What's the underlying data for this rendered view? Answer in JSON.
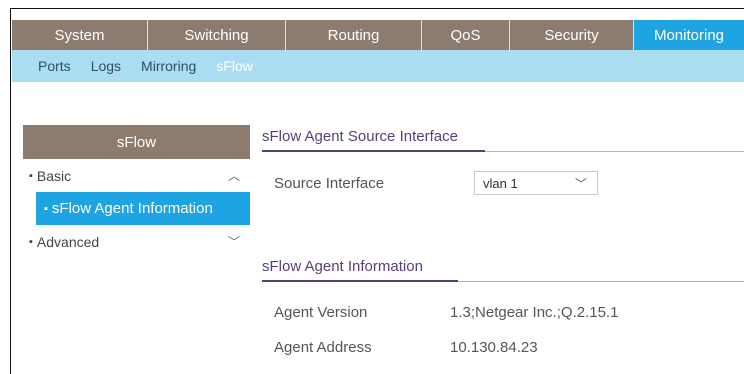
{
  "topnav": {
    "tabs": [
      {
        "label": "System"
      },
      {
        "label": "Switching"
      },
      {
        "label": "Routing"
      },
      {
        "label": "QoS"
      },
      {
        "label": "Security"
      },
      {
        "label": "Monitoring"
      }
    ],
    "active": "Monitoring"
  },
  "subnav": {
    "items": [
      {
        "label": "Ports"
      },
      {
        "label": "Logs"
      },
      {
        "label": "Mirroring"
      },
      {
        "label": "sFlow"
      }
    ],
    "active": "sFlow"
  },
  "sidebar": {
    "title": "sFlow",
    "items": [
      {
        "label": "Basic",
        "icon": "chevron-up-icon"
      },
      {
        "label": "sFlow Agent Information"
      },
      {
        "label": "Advanced",
        "icon": "chevron-down-icon"
      }
    ]
  },
  "source_section": {
    "title": "sFlow Agent Source Interface",
    "field_label": "Source Interface",
    "selected_value": "vlan 1"
  },
  "agent_section": {
    "title": "sFlow Agent Information",
    "rows": [
      {
        "label": "Agent Version",
        "value": "1.3;Netgear Inc.;Q.2.15.1"
      },
      {
        "label": "Agent Address",
        "value": "10.130.84.23"
      }
    ]
  },
  "colors": {
    "nav_brown": "#8c7b6f",
    "accent_blue": "#1ea3e3",
    "subnav_blue": "#aadcf2",
    "section_purple": "#5a3e7a"
  }
}
